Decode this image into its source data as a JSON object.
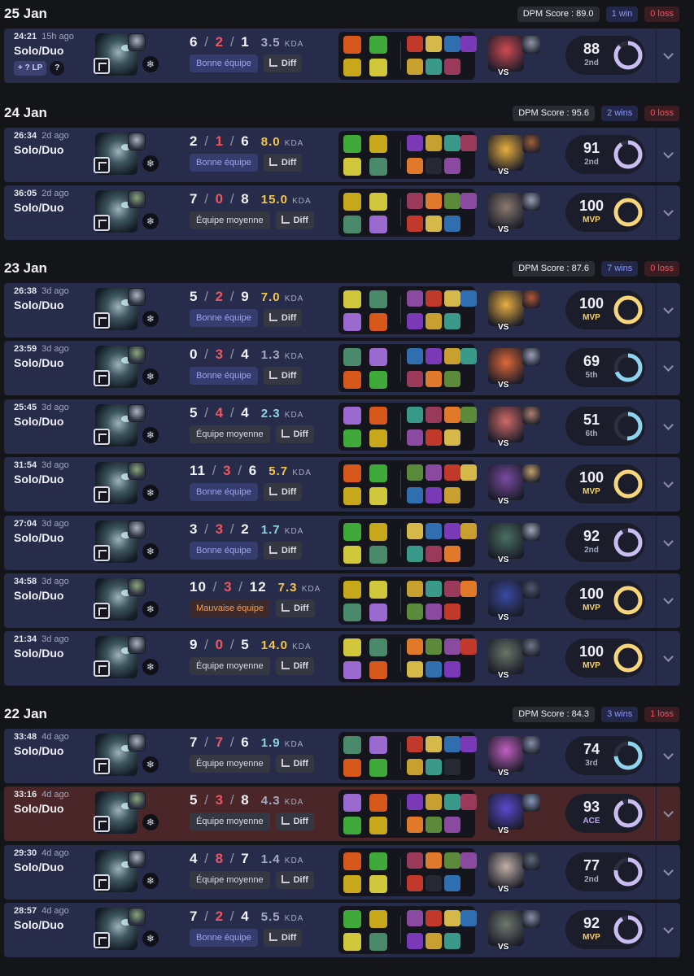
{
  "colors": {
    "win_card": "#262c4a",
    "loss_card": "#4a2628",
    "kda_high": "#f5c64a",
    "kda_mid": "#8fd4e6",
    "kda_low": "#a6aac0",
    "mvp": "#f5d06a",
    "ace": "#b9a6f2",
    "ring_gold": "#f7d57a",
    "ring_lilac": "#c9bdf2",
    "ring_blue": "#8fd4ee"
  },
  "days": [
    {
      "date": "25 Jan",
      "dpm": "DPM Score : 89.0",
      "wins": "1 win",
      "losses": "0 loss",
      "matches": [
        {
          "time": "24:21",
          "ago": "15h ago",
          "queue": "Solo/Duo",
          "lp": "+ ? LP",
          "lp_q": "?",
          "k": "6",
          "d": "2",
          "a": "1",
          "ratio": "3.5",
          "ratio_tier": "low",
          "team": "Bonne équipe",
          "team_type": "good",
          "diff": "Diff",
          "score": "88",
          "rank": "2nd",
          "ring": "lilac",
          "result": "win",
          "opp": [
            "#d04a52",
            "#8f96a8"
          ]
        }
      ]
    },
    {
      "date": "24 Jan",
      "dpm": "DPM Score : 95.6",
      "wins": "2 wins",
      "losses": "0 loss",
      "matches": [
        {
          "time": "26:34",
          "ago": "2d ago",
          "queue": "Solo/Duo",
          "k": "2",
          "d": "1",
          "a": "6",
          "ratio": "8.0",
          "ratio_tier": "high",
          "team": "Bonne équipe",
          "team_type": "good",
          "diff": "Diff",
          "score": "91",
          "rank": "2nd",
          "ring": "lilac",
          "result": "win",
          "opp": [
            "#e8b040",
            "#a0603a"
          ]
        },
        {
          "time": "36:05",
          "ago": "2d ago",
          "queue": "Solo/Duo",
          "k": "7",
          "d": "0",
          "a": "8",
          "ratio": "15.0",
          "ratio_tier": "high",
          "team": "Équipe moyenne",
          "team_type": "avg",
          "diff": "Diff",
          "score": "100",
          "rank": "MVP",
          "ring": "gold",
          "result": "win",
          "opp": [
            "#8a7a70",
            "#9aa0b4"
          ]
        }
      ]
    },
    {
      "date": "23 Jan",
      "dpm": "DPM Score : 87.6",
      "wins": "7 wins",
      "losses": "0 loss",
      "matches": [
        {
          "time": "26:38",
          "ago": "3d ago",
          "queue": "Solo/Duo",
          "k": "5",
          "d": "2",
          "a": "9",
          "ratio": "7.0",
          "ratio_tier": "high",
          "team": "Bonne équipe",
          "team_type": "good",
          "diff": "Diff",
          "score": "100",
          "rank": "MVP",
          "ring": "gold",
          "result": "win",
          "opp": [
            "#e8b040",
            "#b05838"
          ]
        },
        {
          "time": "23:59",
          "ago": "3d ago",
          "queue": "Solo/Duo",
          "k": "0",
          "d": "3",
          "a": "4",
          "ratio": "1.3",
          "ratio_tier": "low",
          "team": "Bonne équipe",
          "team_type": "good",
          "diff": "Diff",
          "score": "69",
          "rank": "5th",
          "ring": "blue",
          "result": "win",
          "opp": [
            "#e06838",
            "#9aa0b8"
          ]
        },
        {
          "time": "25:45",
          "ago": "3d ago",
          "queue": "Solo/Duo",
          "k": "5",
          "d": "4",
          "a": "4",
          "ratio": "2.3",
          "ratio_tier": "mid",
          "team": "Équipe moyenne",
          "team_type": "avg",
          "diff": "Diff",
          "score": "51",
          "rank": "6th",
          "ring": "blue",
          "result": "win",
          "opp": [
            "#d06a68",
            "#b08070"
          ]
        },
        {
          "time": "31:54",
          "ago": "3d ago",
          "queue": "Solo/Duo",
          "k": "11",
          "d": "3",
          "a": "6",
          "ratio": "5.7",
          "ratio_tier": "high",
          "team": "Bonne équipe",
          "team_type": "good",
          "diff": "Diff",
          "score": "100",
          "rank": "MVP",
          "ring": "gold",
          "result": "win",
          "opp": [
            "#7a4aa0",
            "#c0a070"
          ]
        },
        {
          "time": "27:04",
          "ago": "3d ago",
          "queue": "Solo/Duo",
          "k": "3",
          "d": "3",
          "a": "2",
          "ratio": "1.7",
          "ratio_tier": "mid",
          "team": "Bonne équipe",
          "team_type": "good",
          "diff": "Diff",
          "score": "92",
          "rank": "2nd",
          "ring": "lilac",
          "result": "win",
          "opp": [
            "#4a7060",
            "#a0a8b8"
          ]
        },
        {
          "time": "34:58",
          "ago": "3d ago",
          "queue": "Solo/Duo",
          "k": "10",
          "d": "3",
          "a": "12",
          "ratio": "7.3",
          "ratio_tier": "high",
          "team": "Mauvaise équipe",
          "team_type": "bad",
          "diff": "Diff",
          "score": "100",
          "rank": "MVP",
          "ring": "gold",
          "result": "win",
          "opp": [
            "#3a4aa0",
            "#505870"
          ]
        },
        {
          "time": "21:34",
          "ago": "3d ago",
          "queue": "Solo/Duo",
          "k": "9",
          "d": "0",
          "a": "5",
          "ratio": "14.0",
          "ratio_tier": "high",
          "team": "Équipe moyenne",
          "team_type": "avg",
          "diff": "Diff",
          "score": "100",
          "rank": "MVP",
          "ring": "gold",
          "result": "win",
          "opp": [
            "#6a7468",
            "#707888"
          ]
        }
      ]
    },
    {
      "date": "22 Jan",
      "dpm": "DPM Score : 84.3",
      "wins": "3 wins",
      "losses": "1 loss",
      "matches": [
        {
          "time": "33:48",
          "ago": "4d ago",
          "queue": "Solo/Duo",
          "k": "7",
          "d": "7",
          "a": "6",
          "ratio": "1.9",
          "ratio_tier": "mid",
          "team": "Équipe moyenne",
          "team_type": "avg",
          "diff": "Diff",
          "score": "74",
          "rank": "3rd",
          "ring": "blue",
          "result": "win",
          "opp": [
            "#c060c0",
            "#8890a8"
          ]
        },
        {
          "time": "33:16",
          "ago": "4d ago",
          "queue": "Solo/Duo",
          "k": "5",
          "d": "3",
          "a": "8",
          "ratio": "4.3",
          "ratio_tier": "low",
          "team": "Équipe moyenne",
          "team_type": "avg",
          "diff": "Diff",
          "score": "93",
          "rank": "ACE",
          "ring": "lilac",
          "result": "loss",
          "opp": [
            "#5a4ad0",
            "#8898b8"
          ]
        },
        {
          "time": "29:30",
          "ago": "4d ago",
          "queue": "Solo/Duo",
          "k": "4",
          "d": "8",
          "a": "7",
          "ratio": "1.4",
          "ratio_tier": "low",
          "team": "Équipe moyenne",
          "team_type": "avg",
          "diff": "Diff",
          "score": "77",
          "rank": "2nd",
          "ring": "lilac",
          "result": "win",
          "opp": [
            "#c0b0a8",
            "#606878"
          ]
        },
        {
          "time": "28:57",
          "ago": "4d ago",
          "queue": "Solo/Duo",
          "k": "7",
          "d": "2",
          "a": "4",
          "ratio": "5.5",
          "ratio_tier": "low",
          "team": "Bonne équipe",
          "team_type": "good",
          "diff": "Diff",
          "score": "92",
          "rank": "MVP",
          "ring": "lilac",
          "result": "win",
          "opp": [
            "#707870",
            "#8890a8"
          ]
        }
      ]
    }
  ],
  "vs_label": "VS",
  "kda_suffix": "KDA"
}
